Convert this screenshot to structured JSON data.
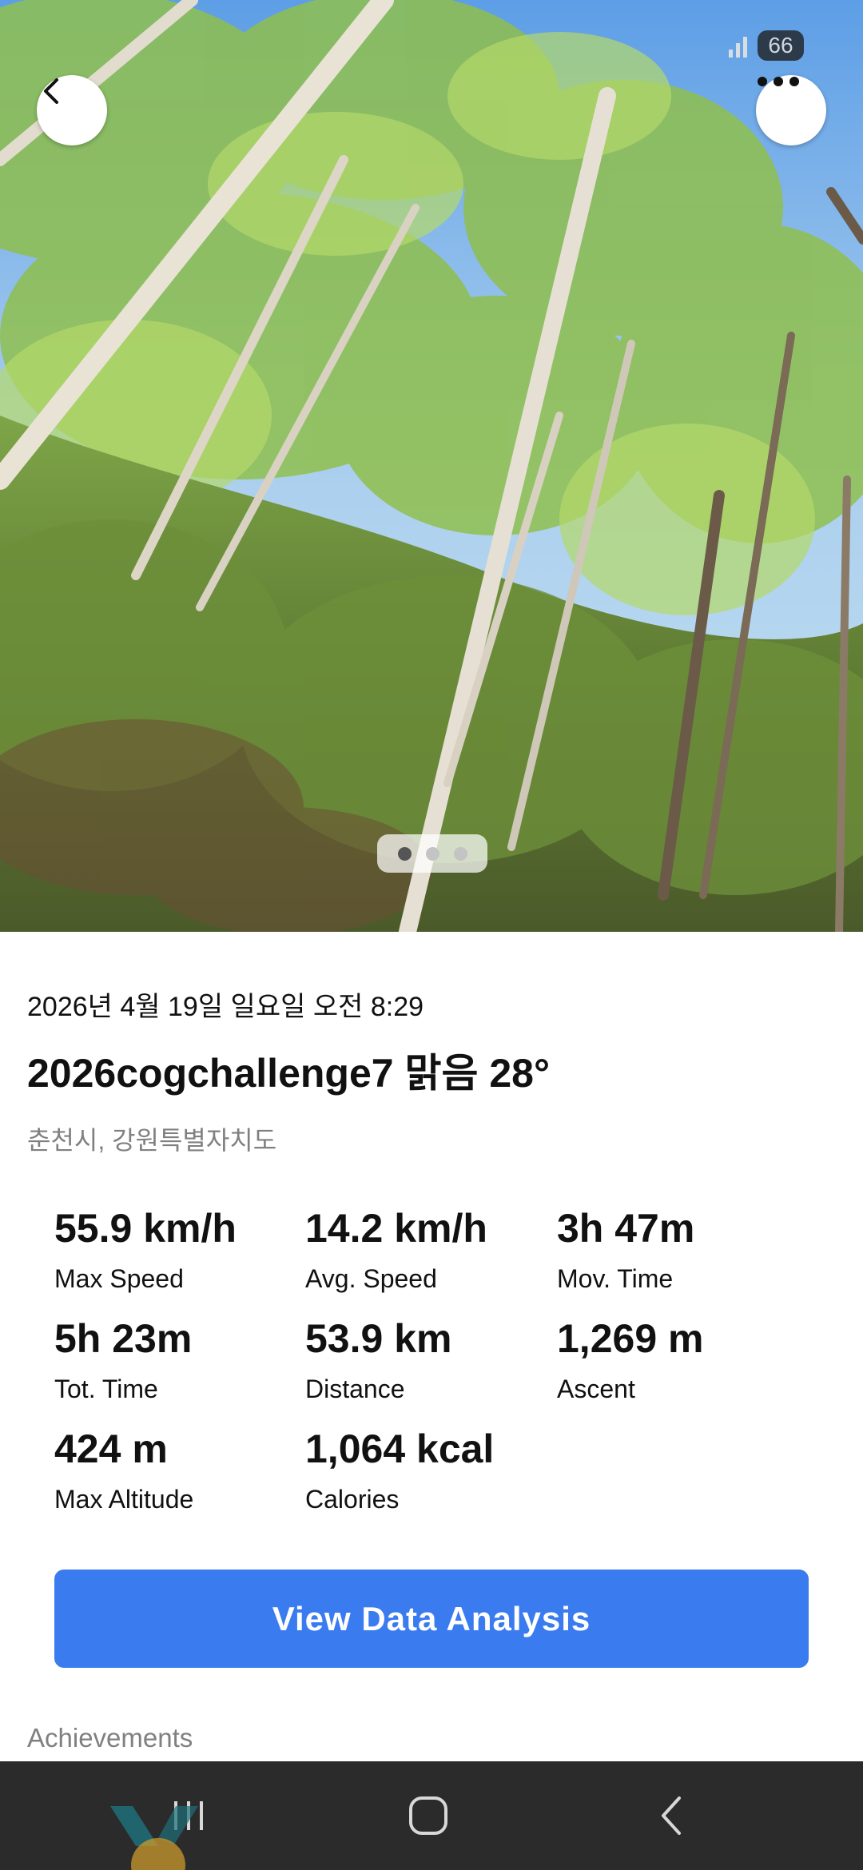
{
  "status": {
    "battery": "66"
  },
  "header": {
    "back_icon": "chevron-left-icon",
    "more_icon": "more-horizontal-icon"
  },
  "carousel": {
    "total": 3,
    "active": 0
  },
  "activity": {
    "date": "2026년 4월 19일 일요일 오전 8:29",
    "title": "2026cogchallenge7 맑음  28°",
    "location": "춘천시, 강원특별자치도"
  },
  "stats": [
    {
      "value": "55.9 km/h",
      "label": "Max Speed"
    },
    {
      "value": "14.2 km/h",
      "label": "Avg. Speed"
    },
    {
      "value": "3h 47m",
      "label": "Mov. Time"
    },
    {
      "value": "5h 23m",
      "label": "Tot. Time"
    },
    {
      "value": "53.9 km",
      "label": "Distance"
    },
    {
      "value": "1,269 m",
      "label": "Ascent"
    },
    {
      "value": "424 m",
      "label": "Max Altitude"
    },
    {
      "value": "1,064 kcal",
      "label": "Calories"
    }
  ],
  "cta": {
    "label": "View Data Analysis",
    "color": "#3a7bf0"
  },
  "achievements": {
    "label": "Achievements"
  },
  "navbar": {
    "recents_icon": "recents-icon",
    "home_icon": "home-icon",
    "back_icon": "back-icon"
  }
}
